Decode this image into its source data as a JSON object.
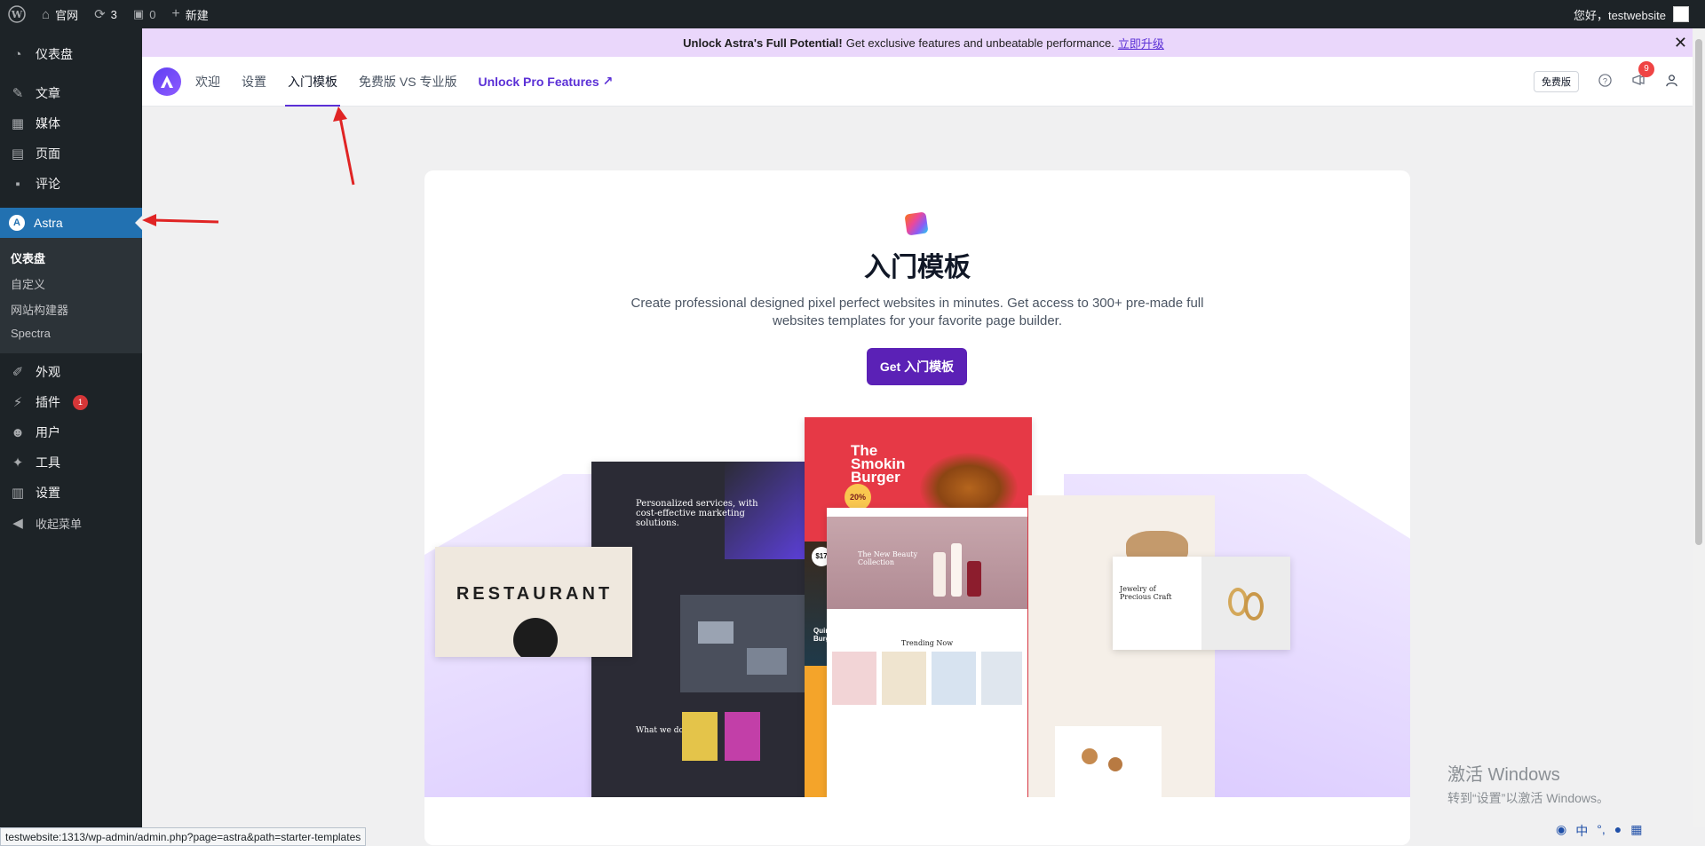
{
  "adminbar": {
    "site_name": "官网",
    "updates_count": "3",
    "comments_count": "0",
    "new_label": "新建",
    "greeting": "您好，testwebsite"
  },
  "sidebar": {
    "dashboard": "仪表盘",
    "posts": "文章",
    "media": "媒体",
    "pages": "页面",
    "comments": "评论",
    "astra": "Astra",
    "astra_sub": [
      "仪表盘",
      "自定义",
      "网站构建器",
      "Spectra"
    ],
    "appearance": "外观",
    "plugins": "插件",
    "plugins_badge": "1",
    "users": "用户",
    "tools": "工具",
    "settings": "设置",
    "collapse": "收起菜单"
  },
  "promo": {
    "bold": "Unlock Astra's Full Potential!",
    "text": "Get exclusive features and unbeatable performance.",
    "link": "立即升级",
    "close": "✕"
  },
  "astranav": {
    "tabs": [
      "欢迎",
      "设置",
      "入门模板",
      "免费版 VS 专业版"
    ],
    "pro_link": "Unlock Pro Features",
    "pro_arrow": "↗",
    "plan": "免费版",
    "notif_count": "9"
  },
  "card": {
    "title": "入门模板",
    "description": "Create professional designed pixel perfect websites in minutes. Get access to 300+ pre-made full websites templates for your favorite page builder.",
    "button": "Get 入门模板",
    "templates": {
      "restaurant": "RESTAURANT",
      "burger_title": "The Smokin Burger",
      "burger_offer": "20%",
      "burger_price": "$17",
      "burger_item": "Quinoa & Black Bean Burger",
      "agency": "Personalized services, with cost-effective marketing solutions.",
      "agency_what": "What we do",
      "beauty": "The New Beauty Collection",
      "trending": "Trending Now",
      "jewelry": "Jewelry of Precious Craft"
    }
  },
  "statusbar": {
    "url": "testwebsite:1313/wp-admin/admin.php?page=astra&path=starter-templates"
  },
  "watermark": {
    "line1": "激活 Windows",
    "line2": "转到“设置”以激活 Windows。"
  },
  "ime": {
    "lang": "中"
  }
}
